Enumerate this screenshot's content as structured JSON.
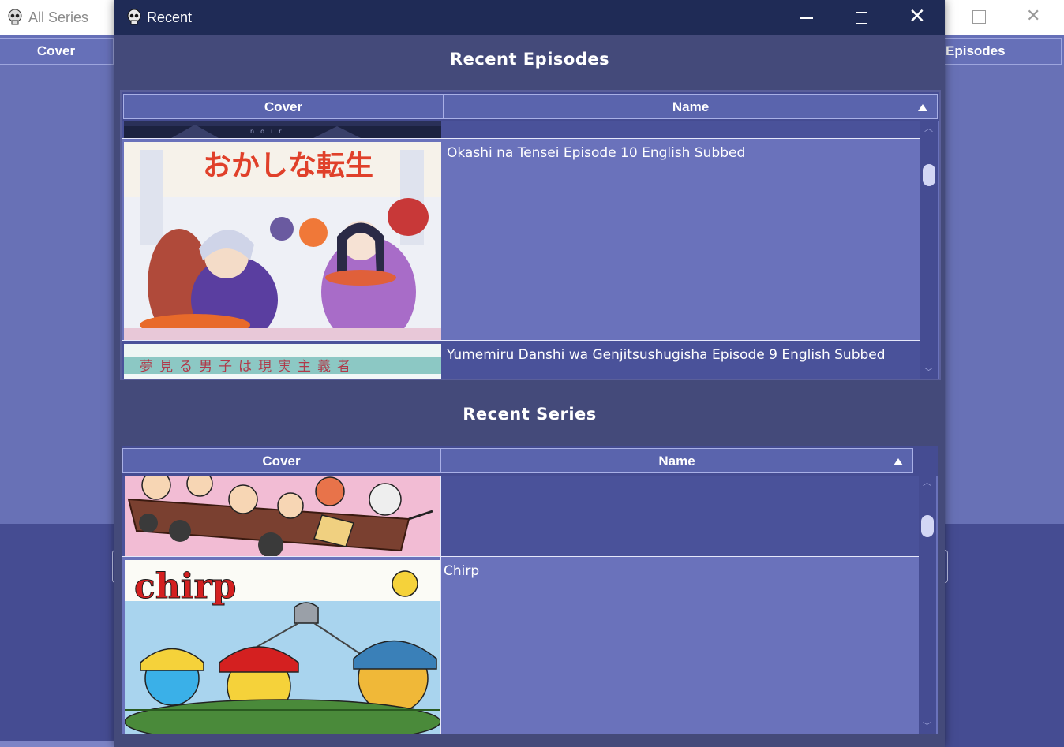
{
  "background_window": {
    "title": "All Series",
    "header": {
      "cover_label": "Cover",
      "episodes_label": "Episodes"
    }
  },
  "window": {
    "title": "Recent",
    "controls": {
      "minimize": "minimize",
      "maximize": "maximize",
      "close": "close"
    }
  },
  "recent_episodes": {
    "title": "Recent Episodes",
    "columns": {
      "cover": "Cover",
      "name": "Name"
    },
    "rows": [
      {
        "name": ""
      },
      {
        "name": "Okashi na Tensei Episode 10 English Subbed"
      },
      {
        "name": "Yumemiru Danshi wa Genjitsushugisha Episode 9 English Subbed"
      }
    ]
  },
  "recent_series": {
    "title": "Recent Series",
    "columns": {
      "cover": "Cover",
      "name": "Name"
    },
    "rows": [
      {
        "name": ""
      },
      {
        "name": "Chirp"
      }
    ]
  },
  "covers": {
    "okashi_text": "おかしな転生",
    "yumemiru_text": "夢見る男子は現実主義者",
    "chirp_text": "chirp"
  },
  "colors": {
    "window_bg": "#444a7a",
    "titlebar": "#1f2b56",
    "row_light": "#6a72bb",
    "row_dark": "#4a529a",
    "header": "#5a64ad"
  }
}
